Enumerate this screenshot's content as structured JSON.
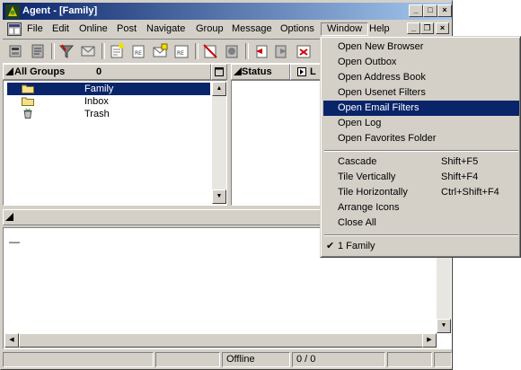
{
  "window": {
    "title": "Agent - [Family]",
    "caption_buttons": {
      "minimize": "_",
      "maximize": "□",
      "close": "×"
    },
    "mdi_buttons": {
      "minimize": "_",
      "restore": "❐",
      "close": "×"
    }
  },
  "menubar": {
    "items": [
      "File",
      "Edit",
      "Online",
      "Post",
      "Navigate",
      "Group",
      "Message",
      "Options",
      "Window",
      "Help"
    ]
  },
  "groups_pane": {
    "header": "All Groups",
    "count": "0",
    "folders": [
      {
        "label": "Family",
        "icon": "folder-icon",
        "selected": true
      },
      {
        "label": "Inbox",
        "icon": "folder-icon",
        "selected": false
      },
      {
        "label": "Trash",
        "icon": "trash-icon",
        "selected": false
      }
    ]
  },
  "messages_pane": {
    "status_header": "Status",
    "next_header": "L"
  },
  "message_body": {
    "text": "—"
  },
  "statusbar": {
    "connection": "Offline",
    "counter": "0 / 0"
  },
  "window_menu": {
    "group1": [
      "Open New Browser",
      "Open Outbox",
      "Open Address Book",
      "Open Usenet Filters",
      "Open Email Filters",
      "Open Log",
      "Open Favorites Folder"
    ],
    "highlighted": "Open Email Filters",
    "group2": [
      {
        "label": "Cascade",
        "shortcut": "Shift+F5"
      },
      {
        "label": "Tile Vertically",
        "shortcut": "Shift+F4"
      },
      {
        "label": "Tile Horizontally",
        "shortcut": "Ctrl+Shift+F4"
      },
      {
        "label": "Arrange Icons",
        "shortcut": ""
      },
      {
        "label": "Close All",
        "shortcut": ""
      }
    ],
    "group3": [
      {
        "label": "1 Family",
        "checked": true
      }
    ],
    "check_glyph": "✔"
  },
  "colors": {
    "title_active": "#0a246a",
    "title_fade": "#a6caf0",
    "selection": "#0a246a",
    "face": "#d4d0c8"
  }
}
